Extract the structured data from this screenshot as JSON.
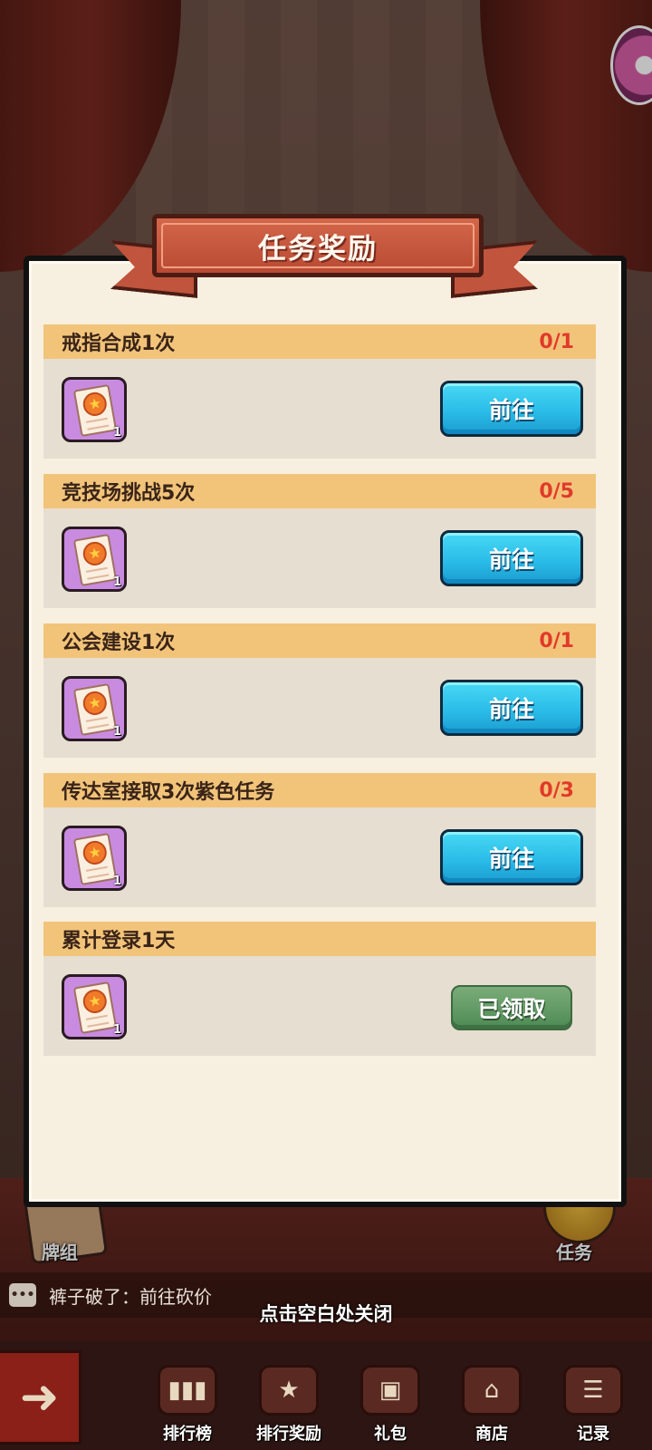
{
  "modal": {
    "title": "任务奖励",
    "close_hint": "点击空白处关闭"
  },
  "tasks": [
    {
      "name": "戒指合成1次",
      "progress": "0/1",
      "reward_count": "1",
      "action": "前往",
      "status": "go"
    },
    {
      "name": "竞技场挑战5次",
      "progress": "0/5",
      "reward_count": "1",
      "action": "前往",
      "status": "go"
    },
    {
      "name": "公会建设1次",
      "progress": "0/1",
      "reward_count": "1",
      "action": "前往",
      "status": "go"
    },
    {
      "name": "传达室接取3次紫色任务",
      "progress": "0/3",
      "reward_count": "1",
      "action": "前往",
      "status": "go"
    },
    {
      "name": "累计登录1天",
      "progress": "",
      "reward_count": "1",
      "action": "已领取",
      "status": "claimed"
    }
  ],
  "scene": {
    "deck_label": "牌组",
    "task_label": "任务",
    "ticker_text": "裤子破了：前往砍价"
  },
  "nav": {
    "back_icon": "back-arrow-icon",
    "items": [
      {
        "label": "排行榜",
        "icon": "leaderboard-icon"
      },
      {
        "label": "排行奖励",
        "icon": "star-trophy-icon"
      },
      {
        "label": "礼包",
        "icon": "gift-icon"
      },
      {
        "label": "商店",
        "icon": "shop-icon"
      },
      {
        "label": "记录",
        "icon": "record-icon"
      }
    ]
  },
  "colors": {
    "go_button": "#2bbde8",
    "claimed_button": "#5a9460",
    "progress_text": "#e03a2a",
    "task_header": "#f2c47a",
    "ribbon": "#c0543c"
  }
}
